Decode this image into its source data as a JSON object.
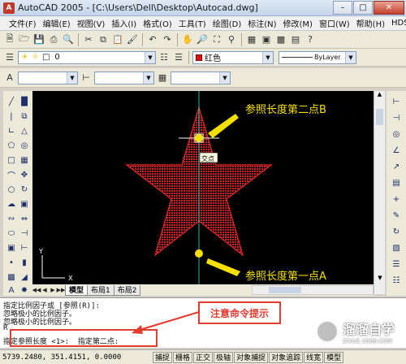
{
  "window": {
    "title": "AutoCAD 2005 - [C:\\Users\\Dell\\Desktop\\Autocad.dwg]",
    "app_icon_glyph": "A"
  },
  "menu": [
    "文件(F)",
    "编辑(E)",
    "视图(V)",
    "插入(I)",
    "格式(O)",
    "工具(T)",
    "绘图(D)",
    "标注(N)",
    "修改(M)",
    "窗口(W)",
    "帮助(H)",
    "HDSHM"
  ],
  "toolbar": {
    "layer_value": "0",
    "color_value": "红色",
    "linetype_value": "ByLayer"
  },
  "tooltip": {
    "text": "交点"
  },
  "canvas": {
    "label_top": "参照长度第二点B",
    "label_bottom": "参照长度第一点A",
    "ucs_x": "X",
    "ucs_y": "Y",
    "star_color": "#e02020",
    "point_color": "#f5e000",
    "annotation_color": "#f5e000"
  },
  "tabs": [
    "模型",
    "布局1",
    "布局2"
  ],
  "command": {
    "lines": [
      "指定比例因子或 [参照(R)]:",
      "忽略极小的比例因子。",
      "忽略极小的比例因子。",
      "R",
      "指定参照长度 <1>:  指定第二点:"
    ]
  },
  "annotation": {
    "text": "注意命令提示",
    "color": "#e23b2f"
  },
  "status": {
    "coords": "5739.2480, 351.4151, 0.0000",
    "buttons": [
      "捕捉",
      "栅格",
      "正交",
      "极轴",
      "对象捕捉",
      "对象追踪",
      "线宽",
      "模型"
    ]
  },
  "watermark": {
    "main": "溜溜自学",
    "sub": "ZIXUE.3D66.COM"
  }
}
